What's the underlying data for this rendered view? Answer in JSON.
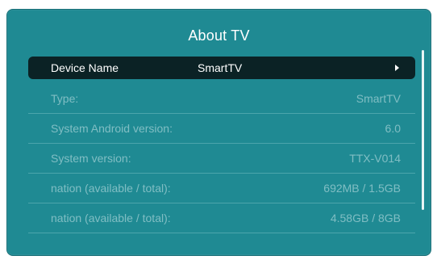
{
  "window": {
    "title": "About TV"
  },
  "menu": {
    "items": [
      {
        "label": "Device Name",
        "value": "SmartTV",
        "selected": true,
        "icon": "chevron-right-icon"
      },
      {
        "label": "Type:",
        "value": "SmartTV"
      },
      {
        "label": "System Android version:",
        "value": "6.0"
      },
      {
        "label": "System version:",
        "value": "TTX-V014"
      },
      {
        "label": "nation (available / total):",
        "value": "692MB / 1.5GB"
      },
      {
        "label": "nation (available / total):",
        "value": "4.58GB / 8GB"
      }
    ]
  },
  "colors": {
    "panel": "#1f8a93",
    "selected_row": "#0b2225",
    "text_primary": "#ffffff",
    "text_dimmed": "#cde8eb",
    "scrollbar": "#e7f4f5"
  }
}
